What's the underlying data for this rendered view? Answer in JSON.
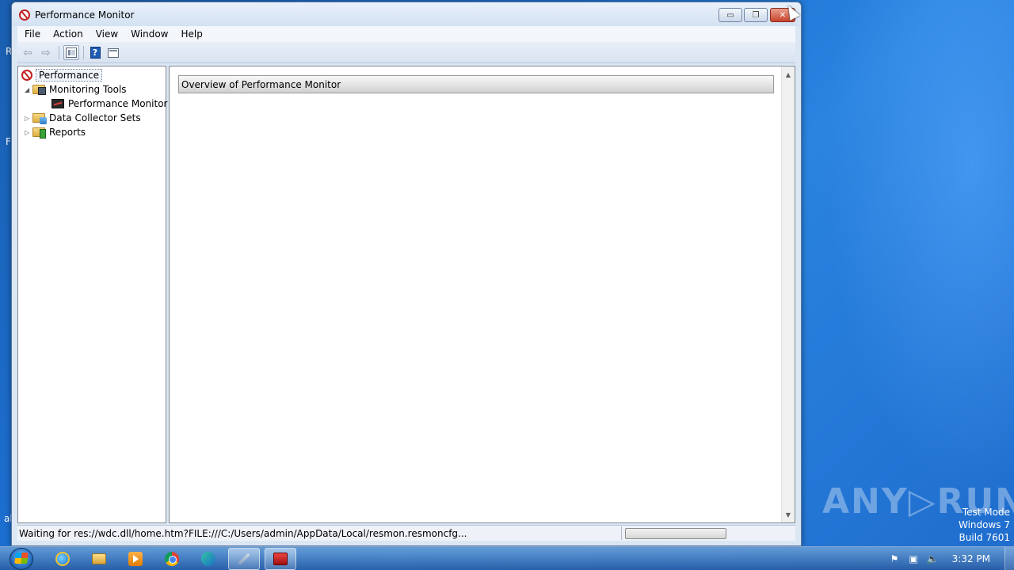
{
  "window": {
    "title": "Performance Monitor",
    "icon": "performance-icon",
    "controls": {
      "minimize": "▭",
      "restore": "❐",
      "close": "✕"
    }
  },
  "menu": {
    "items": [
      "File",
      "Action",
      "View",
      "Window",
      "Help"
    ]
  },
  "toolbar": {
    "back_icon": "⇦",
    "forward_icon": "⇨",
    "help_glyph": "?"
  },
  "tree": {
    "root": "Performance",
    "expanded_arrow": "◢",
    "collapsed_arrow": "▷",
    "monitoring_tools": "Monitoring Tools",
    "performance_monitor": "Performance Monitor",
    "data_collector_sets": "Data Collector Sets",
    "reports": "Reports"
  },
  "content": {
    "overview_header": "Overview of Performance Monitor",
    "scroll_up": "▲",
    "scroll_down": "▼"
  },
  "status": {
    "text": "Waiting for res://wdc.dll/home.htm?FILE:///C:/Users/admin/AppData/Local/resmon.resmoncfg..."
  },
  "desktop": {
    "edge_labels": [
      "R",
      "F",
      "al"
    ],
    "watermark": "ANY▷RUN",
    "test_mode": [
      "Test Mode",
      "Windows 7",
      "Build 7601"
    ]
  },
  "taskbar": {
    "clock": "3:32 PM",
    "apps": [
      "internet-explorer-icon",
      "file-explorer-icon",
      "media-player-icon",
      "chrome-icon",
      "edge-icon",
      "tools-icon",
      "performance-monitor-icon"
    ],
    "tray": {
      "flag": "⚑",
      "network": "▣",
      "volume": "🔈"
    }
  },
  "colors": {
    "close_button": "#c7432c",
    "desktop": "#1c6fd1",
    "header_gradient_bottom": "#d0d0d0"
  }
}
